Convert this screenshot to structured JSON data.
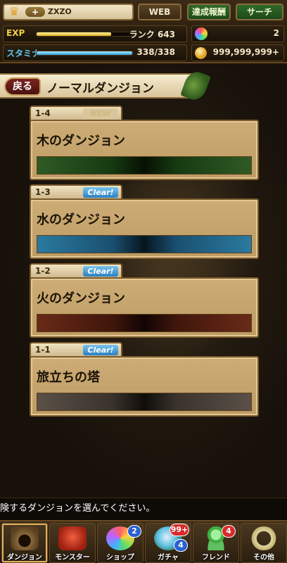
{
  "header": {
    "player_name": "ZXZO",
    "plus_label": "+",
    "buttons": {
      "web": "WEB",
      "achievements": "達成報酬",
      "search": "サーチ"
    },
    "exp": {
      "label": "EXP",
      "rank": "ランク 643",
      "progress": 0.78
    },
    "stamina": {
      "label": "スタミナ",
      "value": "338/338",
      "progress": 1.0
    },
    "magic_stones": "2",
    "coins": "999,999,999+"
  },
  "title_bar": {
    "back_label": "戻る",
    "title": "ノーマルダンジョン"
  },
  "dungeons": [
    {
      "number": "1-4",
      "status": "NEW",
      "name": "木のダンジョン"
    },
    {
      "number": "1-3",
      "status": "Clear!",
      "name": "水のダンジョン"
    },
    {
      "number": "1-2",
      "status": "Clear!",
      "name": "火のダンジョン"
    },
    {
      "number": "1-1",
      "status": "Clear!",
      "name": "旅立ちの塔"
    }
  ],
  "message": "険するダンジョンを選んでください。",
  "nav": [
    {
      "label": "ダンジョン",
      "icon": "dungeon-icon"
    },
    {
      "label": "モンスター",
      "icon": "monster-icon"
    },
    {
      "label": "ショップ",
      "icon": "shop-icon",
      "badge": "2"
    },
    {
      "label": "ガチャ",
      "icon": "gacha-icon",
      "badge": "99+",
      "badge2": "4"
    },
    {
      "label": "フレンド",
      "icon": "friend-icon",
      "badge": "4"
    },
    {
      "label": "その他",
      "icon": "other-icon"
    }
  ],
  "colors": {
    "accent_gold": "#e0b020",
    "stamina_blue": "#2aa0e0",
    "clear_blue": "#2a80c0",
    "title_green": "#3d6b2a"
  }
}
